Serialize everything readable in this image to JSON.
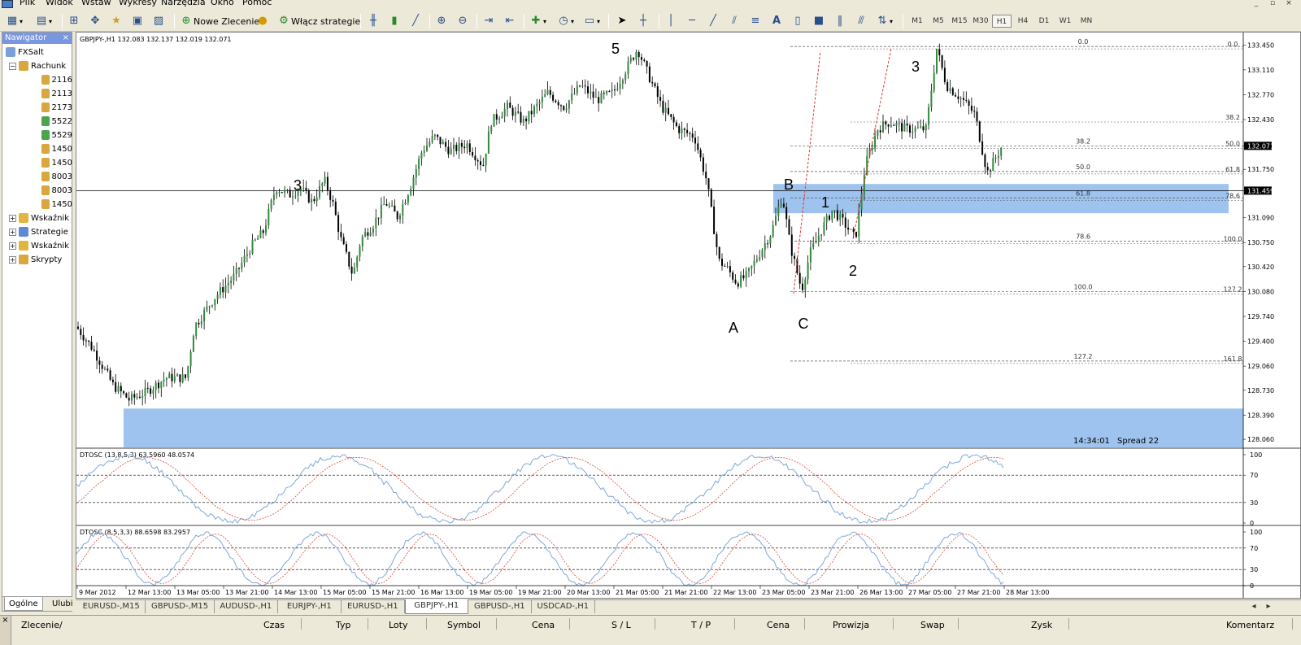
{
  "menu": [
    "Plik",
    "Widok",
    "Wstaw",
    "Wykresy",
    "Narzędzia",
    "Okno",
    "Pomoc"
  ],
  "toolbar": {
    "new_order": "Nowe Zlecenie",
    "strategies": "Włącz strategie",
    "text_tool": "A",
    "timeframes": [
      "M1",
      "M5",
      "M15",
      "M30",
      "H1",
      "H4",
      "D1",
      "W1",
      "MN"
    ],
    "active_timeframe": "H1"
  },
  "navigator": {
    "title": "Nawigator",
    "root": "FXSalt",
    "accounts_label": "Rachunk",
    "accounts": [
      "2116",
      "2113",
      "2173",
      "5522",
      "5529",
      "1450",
      "1450",
      "8003",
      "8003",
      "1450"
    ],
    "groups": [
      "Wskaźnik",
      "Strategie",
      "Wskaźnik",
      "Skrypty"
    ],
    "tabs": [
      "Ogólne",
      "Ulubi"
    ]
  },
  "chart": {
    "header": "GBPJPY-,H1  132.083 132.137 132.019 132.071",
    "current_price": "132.071",
    "line_price": "131.459",
    "price_ticks": [
      "133.450",
      "133.110",
      "132.770",
      "132.430",
      "132.071",
      "131.750",
      "131.459",
      "131.090",
      "130.750",
      "130.420",
      "130.080",
      "129.740",
      "129.400",
      "129.060",
      "128.730",
      "128.390",
      "128.060"
    ],
    "time_labels": [
      "9 Mar 2012",
      "12 Mar 13:00",
      "13 Mar 05:00",
      "13 Mar 21:00",
      "14 Mar 13:00",
      "15 Mar 05:00",
      "15 Mar 21:00",
      "16 Mar 13:00",
      "19 Mar 05:00",
      "19 Mar 21:00",
      "20 Mar 13:00",
      "21 Mar 05:00",
      "21 Mar 21:00",
      "22 Mar 13:00",
      "23 Mar 05:00",
      "23 Mar 21:00",
      "26 Mar 13:00",
      "27 Mar 05:00",
      "27 Mar 21:00",
      "28 Mar 13:00"
    ],
    "wave_labels": [
      "5",
      "3",
      "3",
      "A",
      "B",
      "C",
      "1",
      "2"
    ],
    "fib_left": [
      "0.0",
      "38.2",
      "50.0",
      "61.8",
      "78.6",
      "100.0",
      "127.2"
    ],
    "fib_right": [
      "0.0",
      "38.2",
      "50.0",
      "61.8",
      "78.6",
      "100.0",
      "127.2",
      "161.8"
    ],
    "server_time": "14:34:01",
    "spread": "Spread 22",
    "osc1_label": "DTOSC (13,8,5,3) 63.5960 48.0574",
    "osc2_label": "DTOSC (8,5,3,3) 88.6598 83.2957",
    "osc_levels": [
      "70",
      "30",
      "0"
    ],
    "osc_top": "100",
    "colors": {
      "candle": "#000000",
      "candle_up": "#2e8b3a",
      "zone": "#9dc3ee",
      "fib": "#555555",
      "osc_fast": "#7fa8d8",
      "osc_slow": "#d84a3a",
      "price_label_bg": "#000000"
    }
  },
  "chart_tabs": [
    "EURUSD-,M15",
    "GBPUSD-,M15",
    "AUDUSD-,H1",
    "EURJPY-,H1",
    "EURUSD-,H1",
    "GBPJPY-,H1",
    "GBPUSD-,H1",
    "USDCAD-,H1"
  ],
  "active_chart_tab": "GBPJPY-,H1",
  "terminal": {
    "columns": [
      "Zlecenie",
      "/",
      "Czas",
      "Typ",
      "Loty",
      "Symbol",
      "Cena",
      "S / L",
      "T / P",
      "Cena",
      "Prowizja",
      "Swap",
      "Zysk",
      "Komentarz"
    ]
  }
}
